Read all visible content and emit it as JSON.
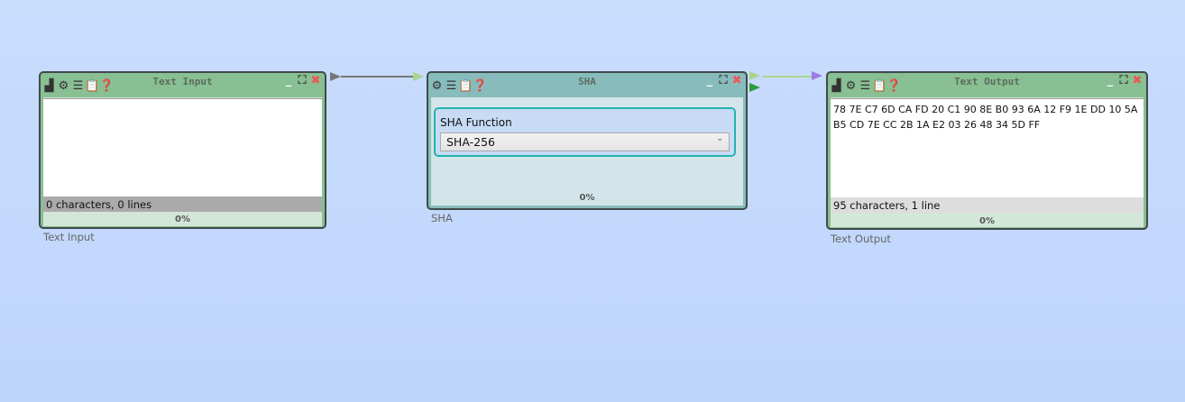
{
  "nodes": {
    "text_input": {
      "title": "Text Input",
      "text": "",
      "status": "0 characters,  0 lines",
      "progress": "0%",
      "label": "Text Input"
    },
    "sha": {
      "title": "SHA",
      "field_label": "SHA Function",
      "selected": "SHA-256",
      "progress": "0%",
      "label": "SHA"
    },
    "text_output": {
      "title": "Text Output",
      "text": "78 7E C7 6D CA FD 20 C1 90 8E B0 93 6A 12 F9 1E DD 10 5A B5 CD 7E CC 2B 1A E2 03 26 48 34 5D FF",
      "status": "95 characters,  1 line",
      "progress": "0%",
      "label": "Text Output"
    }
  },
  "icons": [
    "image-icon",
    "gear-icon",
    "list-icon",
    "clipboard-icon",
    "help-icon",
    "minimize-icon",
    "maximize-icon",
    "close-icon"
  ],
  "colors": {
    "io_header": "#88bf93",
    "sha_header": "#88bcbc",
    "connection": "#a8d48f",
    "purple_port": "#9b7be0"
  }
}
